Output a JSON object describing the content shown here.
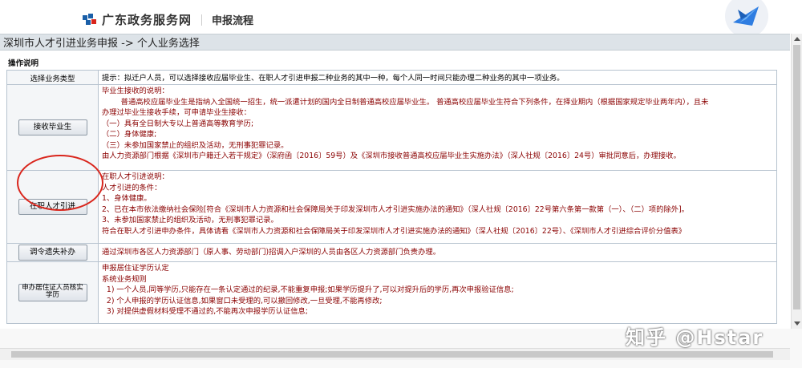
{
  "header": {
    "site_title": "广东政务服务网",
    "flow_title": "申报流程"
  },
  "breadcrumb": "深圳市人才引进业务申报 -> 个人业务选择",
  "section_title": "操作说明",
  "table": {
    "header_left": "选择业务类型",
    "header_right": "提示：拟迁户人员，可以选择接收应届毕业生、在职人才引进申报二种业务的其中一种，每个人同一时间只能办理二种业务的其中一项业务。",
    "rows": [
      {
        "button": "接收毕业生",
        "lines": [
          "毕业生接收的说明：",
          "        普通高校应届毕业生是指纳入全国统一招生，统一派遣计划的国内全日制普通高校应届毕业生。 普通高校应届毕业生符合下列条件，在择业期内（根据国家规定毕业两年内），且未",
          "办理过毕业生接收手续，可申请毕业生接收：",
          "（一）具有全日制大专以上普通高等教育学历;",
          "（二）身体健康;",
          "（三）未参加国家禁止的组织及活动，无刑事犯罪记录。",
          "由人力资源部门根据《深圳市户籍迁入若干规定》（深府函〔2016〕59号）及《深圳市接收普通高校应届毕业生实施办法》（深人社规〔2016〕24号）审批同意后，办理接收。"
        ]
      },
      {
        "button": "在职人才引进",
        "lines": [
          "在职人才引进说明：",
          "人才引进的条件：",
          "1、身体健康。",
          "2、已在本市依法缴纳社会保险[符合《深圳市人力资源和社会保障局关于印发深圳市人才引进实施办法的通知》（深人社规〔2016〕22号第六条第一款第（一）、（二）项的除外]。",
          "3、未参加国家禁止的组织及活动，无刑事犯罪记录。",
          "符合在职人才引进申办条件，具体请看《深圳市人力资源和社会保障局关于印发深圳市人才引进实施办法的通知》（深人社规〔2016〕22号）、《深圳市人才引进综合评价分值表》"
        ]
      },
      {
        "button": "调令遗失补办",
        "lines": [
          "通过深圳市各区人力资源部门（原人事、劳动部门)招调入户深圳的人员由各区人力资源部门负责办理。"
        ]
      },
      {
        "button": "申办居住证人员核实学历",
        "lines": [
          "申报居住证学历认定",
          "系统业务规则",
          "  1) 一个人员,同等学历,只能存在一条认定通过的纪录,不能重复申报;如果学历提升了,可以对提升后的学历,再次申报验证信息;",
          "  2) 个人申报的学历认证信息,如果窗口未受理的,可以撤回修改,一旦受理,不能再修改;",
          "  3) 对提供虚假材料受理不通过的,不能再次申报学历认证信息;"
        ]
      }
    ]
  },
  "watermark": "知乎 @Hstar",
  "colors": {
    "accent_red": "#d9251c",
    "hint_text": "#8a0000",
    "breadcrumb_bg": "#dde3e8",
    "border": "#b7c3cf"
  }
}
